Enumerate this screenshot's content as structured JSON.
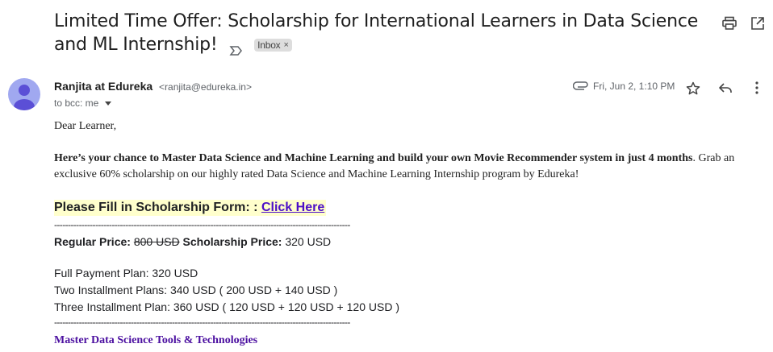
{
  "email": {
    "subject": "Limited Time Offer: Scholarship for International Learners in Data Science and ML Internship!",
    "label_chip": "Inbox",
    "label_chip_close": "×",
    "sender_name": "Ranjita at Edureka",
    "sender_email": "<ranjita@edureka.in>",
    "to_line": "to bcc: me",
    "date": "Fri, Jun 2, 1:10 PM"
  },
  "icons": {
    "print": "print-icon",
    "open_new_window": "open-in-new-window-icon",
    "importance": "importance-marker-icon",
    "attachment": "attachment-icon",
    "star": "star-icon",
    "reply": "reply-icon",
    "more": "more-vert-icon",
    "avatar": "avatar-icon"
  },
  "body": {
    "greeting": "Dear Learner,",
    "intro_bold": "Here’s your chance to Master Data Science and Machine Learning and build your own Movie Recommender system in just 4 months",
    "intro_rest": ". Grab an exclusive 60% scholarship  on our highly rated Data Science and Machine Learning Internship program by Edureka!",
    "cta_label": "Please Fill in Scholarship Form: : ",
    "cta_link": "Click Here",
    "divider": "------------------------------------------------------------------------------------------------------------",
    "regular_price_label": "Regular Price: ",
    "regular_price_value": "800 USD",
    "scholarship_price_label": " Scholarship Price: ",
    "scholarship_price_value": "320 USD",
    "plans": [
      "Full Payment Plan: 320 USD",
      "Two Installment Plans: 340 USD ( 200 USD + 140 USD )",
      "Three Installment Plan: 360 USD ( 120 USD + 120 USD + 120 USD )"
    ],
    "section_heading": "Master Data Science Tools & Technologies"
  },
  "colors": {
    "avatar_bg": "#a0a8f0",
    "avatar_fg": "#5b4fd6",
    "cta_highlight": "#ffffcc",
    "link": "#4b0fc7",
    "section_heading": "#4b0fa0"
  }
}
